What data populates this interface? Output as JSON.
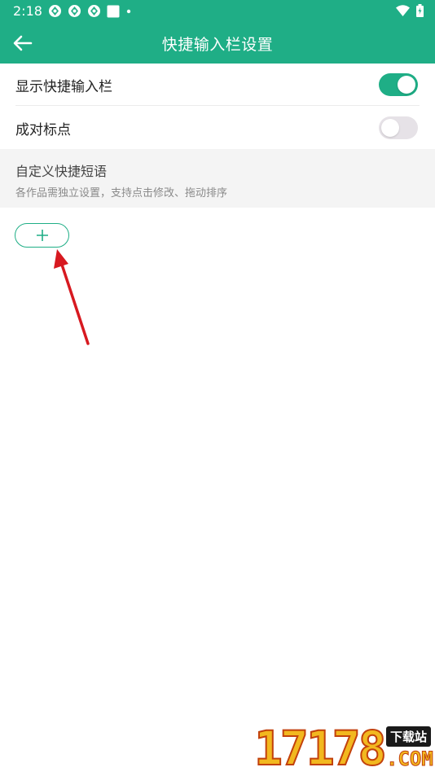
{
  "status_bar": {
    "time": "2:18",
    "icons": [
      "sync-icon",
      "sync-icon",
      "sync-icon",
      "square-icon",
      "dot-icon"
    ],
    "right_icons": [
      "wifi-icon",
      "battery-charging-icon"
    ]
  },
  "app_bar": {
    "title": "快捷输入栏设置",
    "back_icon": "arrow-left-icon"
  },
  "settings": {
    "show_bar": {
      "label": "显示快捷输入栏",
      "enabled": true
    },
    "paired_punct": {
      "label": "成对标点",
      "enabled": false
    }
  },
  "custom_section": {
    "title": "自定义快捷短语",
    "subtitle": "各作品需独立设置，支持点击修改、拖动排序"
  },
  "add_button": {
    "icon": "plus-icon"
  },
  "watermark": {
    "digits": "17178",
    "tag": "下载站",
    "suffix": ".COM"
  },
  "colors": {
    "primary": "#1fae86",
    "toggle_off": "#e6e2e7",
    "section_bg": "#f4f4f4",
    "annotation_arrow": "#d71920"
  }
}
